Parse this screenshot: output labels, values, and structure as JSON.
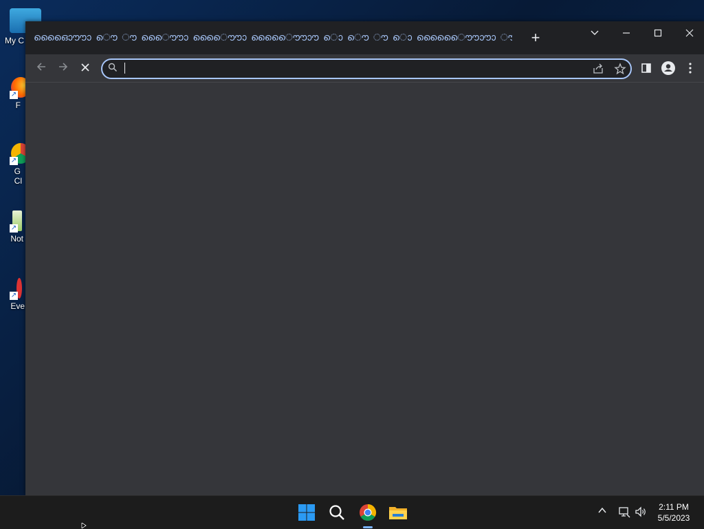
{
  "desktop": {
    "icons": [
      {
        "label": "My C",
        "icon": "computer-icon"
      },
      {
        "label": "F",
        "icon": "firefox-icon"
      },
      {
        "label": "G",
        "label2": "Cl",
        "icon": "chrome-icon"
      },
      {
        "label": "Not",
        "icon": "notepad-icon"
      },
      {
        "label": "Eve",
        "icon": "event-viewer-icon"
      }
    ]
  },
  "browser": {
    "tab": {
      "title": "ഓൌൗൈൊ ൌ ൗ ൌൌൊ ൌൗൈൊ ൌൌൊൗൈ ൊ ൌ ൗ ൊ ൌൌൊൗൈൊ ൗ ൌ ൊൗ ൌ ൌൊ ൗൌൌൊ ൌൊൌൌ ൊൗൌ ൌൊൗൌ",
      "new_tab_label": "+"
    },
    "window_controls": {
      "tab_search": "⌄",
      "minimize": "—",
      "maximize": "☐",
      "close": "✕"
    },
    "toolbar": {
      "back": "←",
      "forward": "→",
      "stop": "✕",
      "omnibox_value": "",
      "omnibox_placeholder": ""
    }
  },
  "taskbar": {
    "pinned": [
      {
        "name": "start-button",
        "icon": "windows-icon"
      },
      {
        "name": "search-button",
        "icon": "search-icon"
      },
      {
        "name": "chrome-button",
        "icon": "chrome-icon",
        "active": true
      },
      {
        "name": "file-explorer-button",
        "icon": "folder-icon"
      }
    ],
    "tray": {
      "chevron": "^",
      "network": "network-icon",
      "volume": "volume-icon"
    },
    "clock": {
      "time": "2:11 PM",
      "date": "5/5/2023"
    }
  },
  "colors": {
    "titlebar": "#202124",
    "toolbar": "#35363a",
    "accent": "#a8c7fa",
    "taskbar": "#1c1c1c"
  }
}
